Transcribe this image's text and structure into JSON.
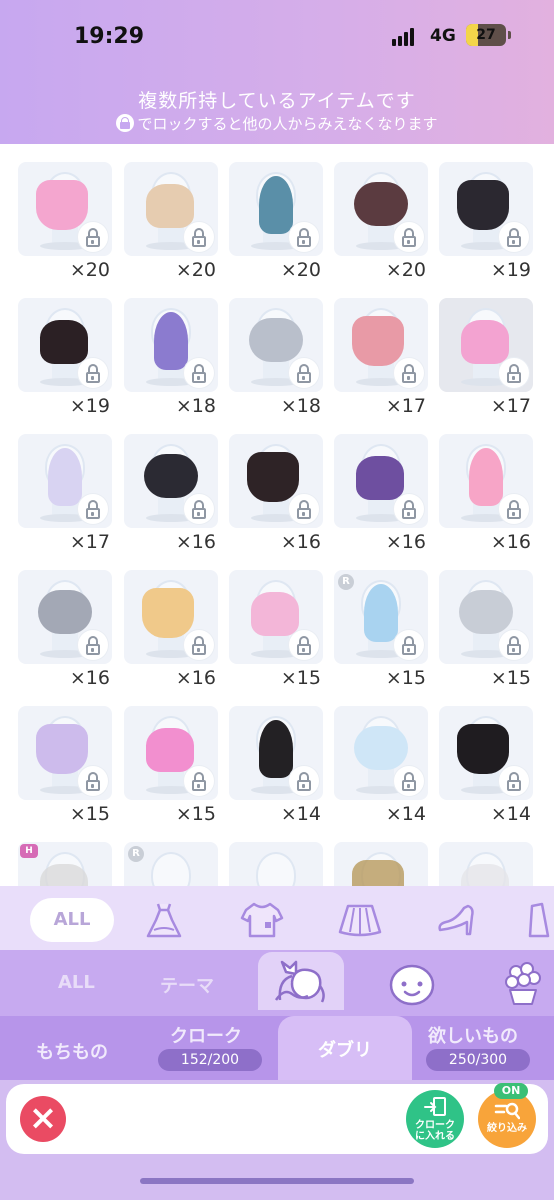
{
  "status": {
    "time": "19:29",
    "network": "4G",
    "battery": "27"
  },
  "header": {
    "title": "複数所持しているアイテムです",
    "subtitle": "でロックすると他の人からみえなくなります"
  },
  "items": [
    {
      "count": "×20",
      "icon": "pink-shorts-icon",
      "color": "#f4a6cf"
    },
    {
      "count": "×20",
      "icon": "beige-bag-icon",
      "color": "#e6ccb0"
    },
    {
      "count": "×20",
      "icon": "pipa-lute-icon",
      "color": "#5a8fa8"
    },
    {
      "count": "×20",
      "icon": "pink-hat-icon",
      "color": "#5b3b40"
    },
    {
      "count": "×19",
      "icon": "black-boots-icon",
      "color": "#2b2830"
    },
    {
      "count": "×19",
      "icon": "black-socks-icon",
      "color": "#2b2024"
    },
    {
      "count": "×18",
      "icon": "purple-skirt-icon",
      "color": "#8b7bcf"
    },
    {
      "count": "×18",
      "icon": "silver-tiara-icon",
      "color": "#b9bfcb"
    },
    {
      "count": "×17",
      "icon": "earring-icon",
      "color": "#e89aa6"
    },
    {
      "count": "×17",
      "icon": "pink-ribbon-top-icon",
      "color": "#f3a3d1"
    },
    {
      "count": "×17",
      "icon": "white-unicorn-icon",
      "color": "#d8d3f2"
    },
    {
      "count": "×16",
      "icon": "kimono-jacket-icon",
      "color": "#2b2a33"
    },
    {
      "count": "×16",
      "icon": "black-shoes-icon",
      "color": "#2e2326"
    },
    {
      "count": "×16",
      "icon": "purple-flower-hairpin-icon",
      "color": "#6e4fa0"
    },
    {
      "count": "×16",
      "icon": "pink-headband-icon",
      "color": "#f7a5c7"
    },
    {
      "count": "×16",
      "icon": "silver-earring-icon",
      "color": "#a3a8b5"
    },
    {
      "count": "×16",
      "icon": "golden-wand-icon",
      "color": "#f0c98a"
    },
    {
      "count": "×15",
      "icon": "pink-dress-icon",
      "color": "#f3b6d8"
    },
    {
      "count": "×15",
      "icon": "blue-headband-icon",
      "color": "#a9d3f0",
      "badge": "R"
    },
    {
      "count": "×15",
      "icon": "small-earring-icon",
      "color": "#c8cdd6"
    },
    {
      "count": "×15",
      "icon": "purple-ground-effect-icon",
      "color": "#cdbbec"
    },
    {
      "count": "×15",
      "icon": "pink-sparkle-icon",
      "color": "#f28fcf"
    },
    {
      "count": "×14",
      "icon": "black-jacket-icon",
      "color": "#232124"
    },
    {
      "count": "×14",
      "icon": "white-blue-jacket-icon",
      "color": "#cfe6f7"
    },
    {
      "count": "×14",
      "icon": "black-puff-top-icon",
      "color": "#1f1c20"
    },
    {
      "count": "",
      "icon": "white-rose-icon",
      "color": "#d9d9d9",
      "badge": "H"
    },
    {
      "count": "",
      "icon": "mannequin-icon",
      "color": "#e8eef6",
      "badge": "R"
    },
    {
      "count": "",
      "icon": "mannequin-icon",
      "color": "#e8eef6"
    },
    {
      "count": "",
      "icon": "gold-earring-icon",
      "color": "#b89a5c"
    },
    {
      "count": "",
      "icon": "white-skirt-icon",
      "color": "#e5e5e8"
    }
  ],
  "categories": {
    "all_label": "ALL",
    "icons": [
      "dress-icon",
      "tshirt-icon",
      "skirt-icon",
      "heel-shoe-icon",
      "jacket-icon"
    ]
  },
  "subfilters": {
    "all_label": "ALL",
    "theme_label": "テーマ",
    "icons": [
      "hairstyle-icon",
      "face-icon",
      "flower-pot-icon"
    ]
  },
  "tabs": {
    "mochimono": "もちもの",
    "cloak": "クローク",
    "cloak_count": "152/200",
    "duplicate": "ダブリ",
    "wishlist": "欲しいもの",
    "wishlist_count": "250/300"
  },
  "actions": {
    "add_to_cloak": "クロークに入れる",
    "filter": "絞り込み",
    "filter_state": "ON"
  }
}
